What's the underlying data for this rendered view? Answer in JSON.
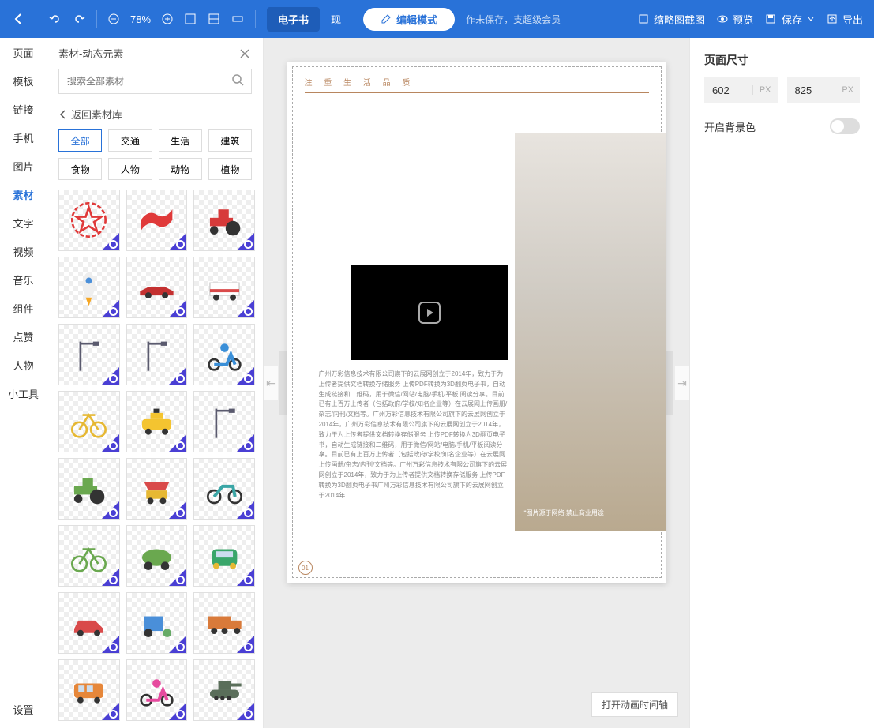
{
  "topbar": {
    "zoom": "78%",
    "mode_ebook": "电子书",
    "mode_other": "现",
    "edit_mode": "编辑模式",
    "status": "作未保存，支超级会员",
    "shrink_btn": "缩略图截图",
    "preview_btn": "预览",
    "save_btn": "保存",
    "export_btn": "导出"
  },
  "sidenav": {
    "items": [
      "页面",
      "模板",
      "链接",
      "手机",
      "图片",
      "素材",
      "文字",
      "视频",
      "音乐",
      "组件",
      "点赞",
      "人物",
      "小工具"
    ],
    "bottom": "设置",
    "active_index": 5
  },
  "panel": {
    "title": "素材-动态元素",
    "search_placeholder": "搜索全部素材",
    "back_label": "返回素材库",
    "categories_row1": [
      "全部",
      "交通",
      "生活",
      "建筑"
    ],
    "categories_row2": [
      "食物",
      "人物",
      "动物",
      "植物"
    ],
    "active_cat": "全部",
    "tiles": [
      {
        "name": "star-badge",
        "fill": "#e03a3a",
        "shape": "star"
      },
      {
        "name": "red-flags",
        "fill": "#e03a3a",
        "shape": "flag"
      },
      {
        "name": "tractor-red",
        "fill": "#d73a3a",
        "shape": "tractor"
      },
      {
        "name": "rocket",
        "fill": "#f5a623",
        "shape": "rocket"
      },
      {
        "name": "race-car",
        "fill": "#c43030",
        "shape": "racecar"
      },
      {
        "name": "ambulance",
        "fill": "#e8e8e8",
        "shape": "ambulance"
      },
      {
        "name": "street-light-1",
        "fill": "#5a5a6e",
        "shape": "lamp"
      },
      {
        "name": "street-light-2",
        "fill": "#5a5a6e",
        "shape": "lamp"
      },
      {
        "name": "scooter-rider",
        "fill": "#3a8fd8",
        "shape": "scooter"
      },
      {
        "name": "bicycle-yellow",
        "fill": "#e6b833",
        "shape": "bike"
      },
      {
        "name": "taxi",
        "fill": "#f4c430",
        "shape": "taxi"
      },
      {
        "name": "street-light-3",
        "fill": "#5a5a6e",
        "shape": "lamp"
      },
      {
        "name": "hay-tractor",
        "fill": "#6aa84f",
        "shape": "tractor"
      },
      {
        "name": "food-cart",
        "fill": "#d94a4a",
        "shape": "cart"
      },
      {
        "name": "motorbike",
        "fill": "#3aa6a6",
        "shape": "moto"
      },
      {
        "name": "bicycle-green",
        "fill": "#6aa84f",
        "shape": "bike"
      },
      {
        "name": "electric-car",
        "fill": "#6aa84f",
        "shape": "ecar"
      },
      {
        "name": "car-front-green",
        "fill": "#3aa66a",
        "shape": "carfront"
      },
      {
        "name": "car-red",
        "fill": "#d94a4a",
        "shape": "car"
      },
      {
        "name": "rickshaw",
        "fill": "#4a8fd9",
        "shape": "rickshaw"
      },
      {
        "name": "truck",
        "fill": "#d97a3a",
        "shape": "truck"
      },
      {
        "name": "van-orange",
        "fill": "#e6873a",
        "shape": "van"
      },
      {
        "name": "scooter-pink",
        "fill": "#e64a9e",
        "shape": "scooter"
      },
      {
        "name": "tank",
        "fill": "#5a6e5a",
        "shape": "tank"
      }
    ]
  },
  "canvas": {
    "page_header": "注 重 生 活 品 质",
    "body_text": "广州万彩信息技术有限公司旗下的云展网创立于2014年，致力于为上传者提供文档转换存储服务 上传PDF转换为3D翻页电子书，自动生成链接和二维码，用于微信/网站/电脑/手机/平板 阅读分享。目前已有上百万上传者（包括政府/学校/知名企业等）在云展网上传画册/杂志/内刊/文档等。广州万彩信息技术有限公司旗下的云展网创立于2014年，广州万彩信息技术有限公司旗下的云展网创立于2014年，致力于为上传者提供文档转换存储服务 上传PDF转换为3D翻页电子书，自动生成链接和二维码，用于微信/网站/电脑/手机/平板阅读分享。目前已有上百万上传者（包括政府/学校/知名企业等）在云展网上传画册/杂志/内刊/文档等。广州万彩信息技术有限公司旗下的云展网创立于2014年，致力于为上传者提供文档转换存储服务 上传PDF转换为3D翻页电子书广州万彩信息技术有限公司旗下的云展网创立于2014年",
    "img_caption": "*图片源于网络,禁止商业用途",
    "page_num": "01",
    "timeline_btn": "打开动画时间轴"
  },
  "rpanel": {
    "size_label": "页面尺寸",
    "width": "602",
    "height": "825",
    "unit": "PX",
    "bg_label": "开启背景色"
  }
}
